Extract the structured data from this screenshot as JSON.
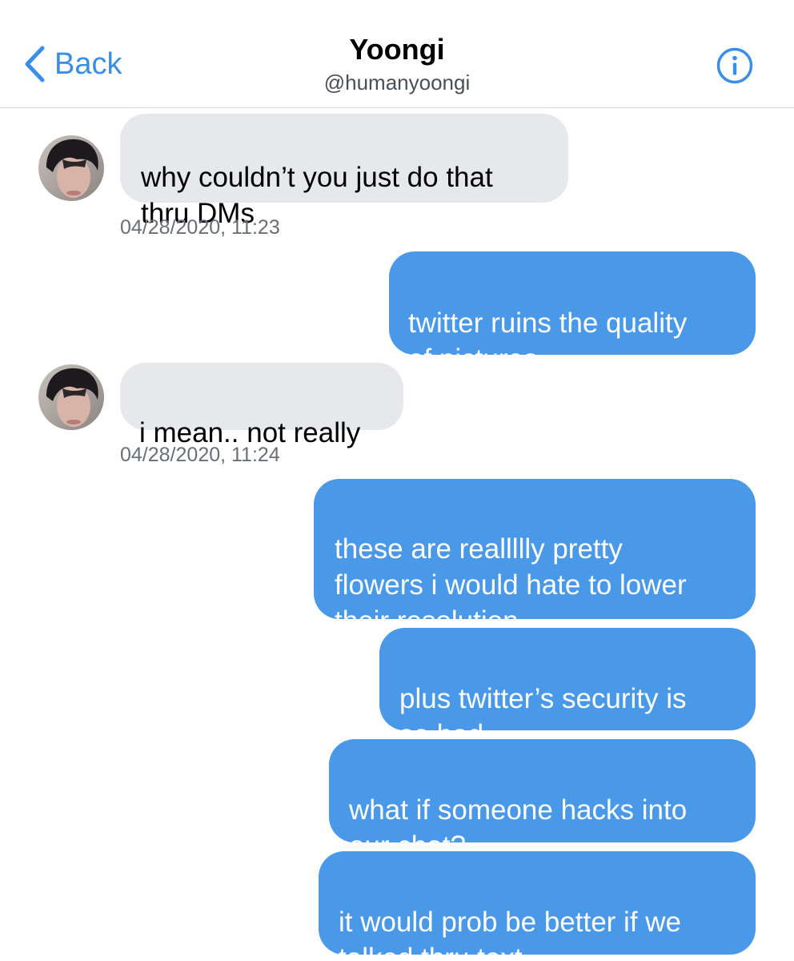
{
  "header": {
    "back_label": "Back",
    "contact_name": "Yoongi",
    "contact_handle": "@humanyoongi"
  },
  "colors": {
    "accent": "#3a8ee6",
    "outgoing_bubble": "#4a99e9",
    "incoming_bubble": "#e7e8ec",
    "divider": "#d3d6da",
    "timestamp_text": "#6a6f75"
  },
  "icons": {
    "back": "chevron-left-icon",
    "info": "info-circle-icon",
    "avatar": "profile-photo"
  },
  "messages": [
    {
      "direction": "incoming",
      "text": "why couldn’t you just do that\nthru DMs",
      "timestamp": "04/28/2020, 11:23"
    },
    {
      "direction": "outgoing",
      "text": "twitter ruins the quality\nof pictures"
    },
    {
      "direction": "incoming",
      "text": "i mean.. not really",
      "timestamp": "04/28/2020, 11:24"
    },
    {
      "direction": "outgoing",
      "text": "these are reallllly pretty\nflowers i would hate to lower\ntheir resolution"
    },
    {
      "direction": "outgoing",
      "text": "plus twitter’s security is\nso bad"
    },
    {
      "direction": "outgoing",
      "text": "what if someone hacks into\nour chat?"
    },
    {
      "direction": "outgoing",
      "text": "it would prob be better if we\ntalked thru text"
    }
  ]
}
